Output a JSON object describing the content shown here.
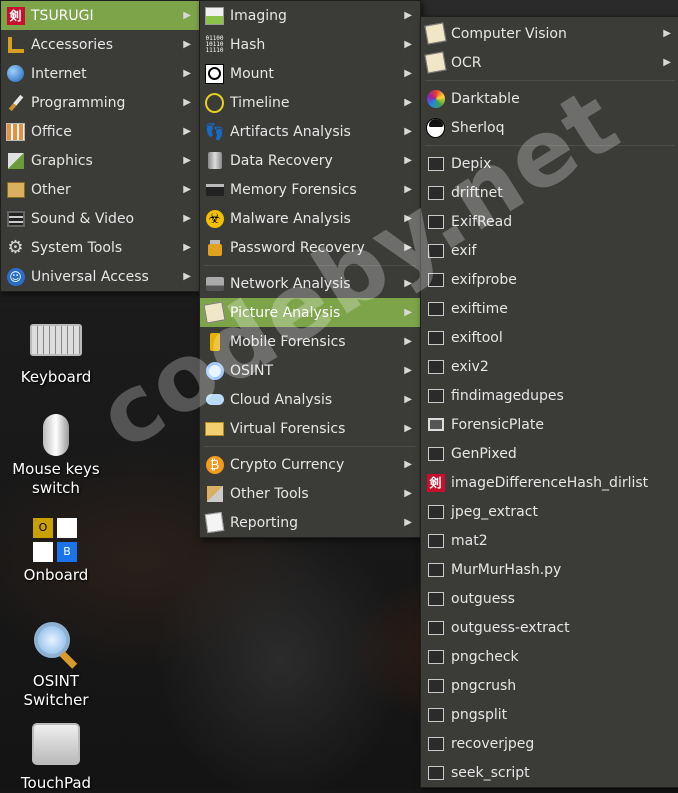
{
  "menu1": [
    {
      "label": "TSURUGI",
      "icon": "tsurugi-icon",
      "active": true
    },
    {
      "label": "Accessories",
      "icon": "accessories-icon"
    },
    {
      "label": "Internet",
      "icon": "globe-icon"
    },
    {
      "label": "Programming",
      "icon": "brush-icon"
    },
    {
      "label": "Office",
      "icon": "office-icon"
    },
    {
      "label": "Graphics",
      "icon": "graphics-icon"
    },
    {
      "label": "Other",
      "icon": "other-icon"
    },
    {
      "label": "Sound & Video",
      "icon": "film-icon"
    },
    {
      "label": "System Tools",
      "icon": "gear-icon"
    },
    {
      "label": "Universal Access",
      "icon": "accessibility-icon"
    }
  ],
  "menu2": [
    {
      "label": "Imaging",
      "icon": "imaging-icon"
    },
    {
      "label": "Hash",
      "icon": "binary-icon"
    },
    {
      "label": "Mount",
      "icon": "mount-icon"
    },
    {
      "label": "Timeline",
      "icon": "clock-icon"
    },
    {
      "label": "Artifacts Analysis",
      "icon": "footprints-icon"
    },
    {
      "label": "Data Recovery",
      "icon": "trash-icon"
    },
    {
      "label": "Memory Forensics",
      "icon": "memory-icon"
    },
    {
      "label": "Malware Analysis",
      "icon": "biohazard-icon"
    },
    {
      "label": "Password Recovery",
      "icon": "lock-icon"
    },
    {
      "label": "Network Analysis",
      "icon": "network-icon",
      "sep_before": true
    },
    {
      "label": "Picture Analysis",
      "icon": "picture-icon",
      "active": true
    },
    {
      "label": "Mobile Forensics",
      "icon": "phone-icon"
    },
    {
      "label": "OSINT",
      "icon": "magnifier-icon"
    },
    {
      "label": "Cloud Analysis",
      "icon": "cloud-icon"
    },
    {
      "label": "Virtual Forensics",
      "icon": "virtual-icon"
    },
    {
      "label": "Crypto Currency",
      "icon": "bitcoin-icon",
      "sep_before": true
    },
    {
      "label": "Other Tools",
      "icon": "tools-icon"
    },
    {
      "label": "Reporting",
      "icon": "report-icon"
    }
  ],
  "menu3": [
    {
      "label": "Computer Vision",
      "icon": "vision-icon",
      "submenu": true
    },
    {
      "label": "OCR",
      "icon": "ocr-icon",
      "submenu": true
    },
    {
      "label": "Darktable",
      "icon": "darktable-icon",
      "sep_before": true
    },
    {
      "label": "Sherloq",
      "icon": "sherloq-icon"
    },
    {
      "label": "Depix",
      "icon": "terminal-icon",
      "sep_before": true
    },
    {
      "label": "driftnet",
      "icon": "terminal-icon"
    },
    {
      "label": "ExifRead",
      "icon": "terminal-icon"
    },
    {
      "label": "exif",
      "icon": "terminal-icon"
    },
    {
      "label": "exifprobe",
      "icon": "terminal-icon"
    },
    {
      "label": "exiftime",
      "icon": "terminal-icon"
    },
    {
      "label": "exiftool",
      "icon": "terminal-icon"
    },
    {
      "label": "exiv2",
      "icon": "terminal-icon"
    },
    {
      "label": "findimagedupes",
      "icon": "terminal-icon"
    },
    {
      "label": "ForensicPlate",
      "icon": "monitor-icon"
    },
    {
      "label": "GenPixed",
      "icon": "terminal-icon"
    },
    {
      "label": "imageDifferenceHash_dirlist",
      "icon": "tsurugi-icon"
    },
    {
      "label": "jpeg_extract",
      "icon": "terminal-icon"
    },
    {
      "label": "mat2",
      "icon": "terminal-icon"
    },
    {
      "label": "MurMurHash.py",
      "icon": "terminal-icon"
    },
    {
      "label": "outguess",
      "icon": "terminal-icon"
    },
    {
      "label": "outguess-extract",
      "icon": "terminal-icon"
    },
    {
      "label": "pngcheck",
      "icon": "terminal-icon"
    },
    {
      "label": "pngcrush",
      "icon": "terminal-icon"
    },
    {
      "label": "pngsplit",
      "icon": "terminal-icon"
    },
    {
      "label": "recoverjpeg",
      "icon": "terminal-icon"
    },
    {
      "label": "seek_script",
      "icon": "terminal-icon"
    }
  ],
  "desktop": {
    "keyboard": "Keyboard",
    "mouse_line1": "Mouse keys",
    "mouse_line2": "switch",
    "onboard": "Onboard",
    "onboard_key_o": "O",
    "onboard_key_b": "B",
    "osint_line1": "OSINT",
    "osint_line2": "Switcher",
    "touchpad": "TouchPad"
  },
  "glyphs": {
    "binary": "01100\n10110\n11110",
    "bitcoin": "₿",
    "biohazard": "☣"
  },
  "watermark": "codeby.net",
  "colors": {
    "menu_bg": "#3b3b38",
    "highlight": "#7ea44a",
    "text": "#e6e6e6"
  }
}
